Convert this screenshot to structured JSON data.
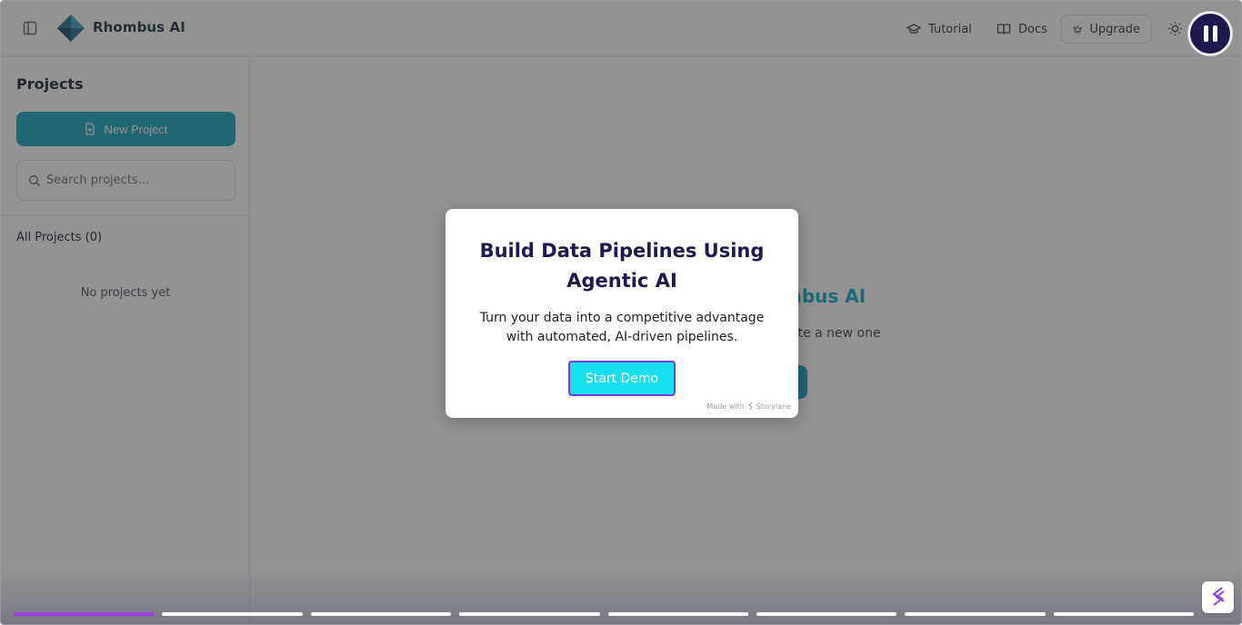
{
  "header": {
    "brand": "Rhombus AI",
    "tutorial_label": "Tutorial",
    "docs_label": "Docs",
    "upgrade_label": "Upgrade",
    "icons": [
      "sidebar-toggle-icon",
      "logo-icon",
      "graduation-cap-icon",
      "book-icon",
      "crown-icon",
      "sun-icon",
      "pause-icon"
    ]
  },
  "sidebar": {
    "title": "Projects",
    "new_project_label": "New Project",
    "search_placeholder": "Search projects...",
    "all_projects_label": "All Projects (0)",
    "empty_label": "No projects yet"
  },
  "main": {
    "title_partial": "mbus AI",
    "subtitle_partial": "ate a new one"
  },
  "modal": {
    "title": "Build Data Pipelines Using Agentic AI",
    "body": "Turn your data into a competitive advantage with automated, AI-driven pipelines.",
    "cta_label": "Start Demo",
    "made_with_prefix": "Made with",
    "made_with_brand": "Storylane"
  },
  "progress": {
    "total_steps": 8,
    "current_step": 1
  },
  "colors": {
    "accent": "#1aa6bf",
    "modal_title": "#1e1a4d",
    "cta_bg": "#19e0ee",
    "cta_border": "#7b3ae0",
    "progress_active": "#9b3de6",
    "pause_bg": "#1e1a4d"
  }
}
